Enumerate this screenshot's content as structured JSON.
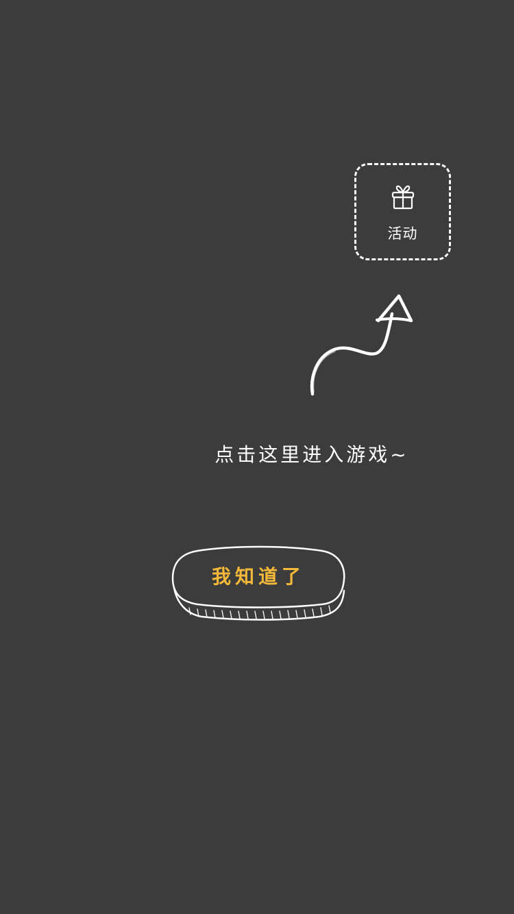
{
  "activity": {
    "icon": "gift-icon",
    "label": "活动"
  },
  "guide": {
    "arrow_icon": "hand-drawn-arrow-icon",
    "hint": "点击这里进入游戏~"
  },
  "confirm": {
    "label": "我知道了"
  },
  "colors": {
    "background": "#3c3c3c",
    "foreground": "#ffffff",
    "accent": "#f5b93a"
  }
}
